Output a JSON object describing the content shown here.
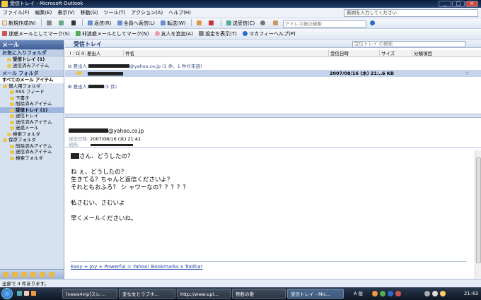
{
  "title": "受信トレイ - Microsoft Outlook",
  "window_buttons": [
    "_",
    "□",
    "×"
  ],
  "menu": [
    "ファイル(F)",
    "編集(E)",
    "表示(V)",
    "移動(G)",
    "ツール(T)",
    "アクション(A)",
    "ヘルプ(H)"
  ],
  "help_placeholder": "質問を入力してください",
  "toolbar1": {
    "new": "新規作成(N)",
    "reply": "返信(R)",
    "reply_all": "全員へ返信(L)",
    "forward": "転送(W)",
    "send_receive": "送受信(C)",
    "address_placeholder": "アドレス帳の検索"
  },
  "toolbar2": {
    "mark_spam": "迷惑メールとしてマーク(S)",
    "mark_not_spam": "非迷惑メールとしてマーク(N)",
    "add_friend": "友人を追加(A)",
    "show_settings": "設定を表示(T)",
    "mcafee": "マカフィーヘルプ(P)"
  },
  "nav": {
    "header": "メール",
    "favorites_title": "お気に入りフォルダ",
    "favorites": [
      "受信トレイ (1)",
      "送信済みアイテム"
    ],
    "mail_folders_title": "メール フォルダ",
    "all_items": "すべてのメール アイテム",
    "tree": [
      "個人用フォルダ",
      "RSS フィード",
      "下書き",
      "削除済みアイテム",
      "受信トレイ (1)",
      "送信トレイ",
      "送信済みアイテム",
      "迷惑メール",
      "検索フォルダ",
      "保存フォルダ",
      "削除済みアイテム",
      "送信済みアイテム",
      "検索フォルダ"
    ]
  },
  "inbox": {
    "title": "受信トレイ",
    "search_placeholder": "受信トレイ の検索"
  },
  "columns": [
    "!",
    "D",
    "0",
    "差出人",
    "件名",
    "受信日時",
    "サイズ",
    "分類項目"
  ],
  "group1_prefix": "差出人:",
  "group1_suffix": "@yahoo.co.jp (1 件、1 件が未読)",
  "message_row": {
    "date": "2007/08/16 (木) 21:...",
    "size": "6 KB"
  },
  "group2_prefix": "差出人:",
  "group2_suffix": "(3 件)",
  "reading": {
    "from_suffix": "@yahoo.co.jp",
    "sent_label": "送信日時:",
    "sent_value": "2007/08/16 (木) 21:41",
    "to_label": "宛先:"
  },
  "body": [
    "さん、どうしたの？",
    "",
    "ね ぇ、どうしたの？",
    "生きてる？ちゃんと返信くださいよ？",
    "それともおふろ？ シ ャワーなの？？？？？",
    "",
    "私さむい、さむいよ",
    "",
    "早くメールくださいね。"
  ],
  "footer_link": "Easy + Joy + Powerful = Yahoo! Bookmarks x Toolbar",
  "status": "全部で 4 件あります。",
  "taskbar": [
    "[news4vip]スレ...",
    "変な女とラブホ...",
    "http://www.upl...",
    "禁断の愛",
    "受信トレイ - Mic..."
  ],
  "tray_label": "A 般",
  "clock": "21:43",
  "colors": {
    "title_bar": "#0b1d3a",
    "nav_bg": "#d7e2f1",
    "selected_row": "#c5d4ec",
    "link": "#2244aa"
  }
}
